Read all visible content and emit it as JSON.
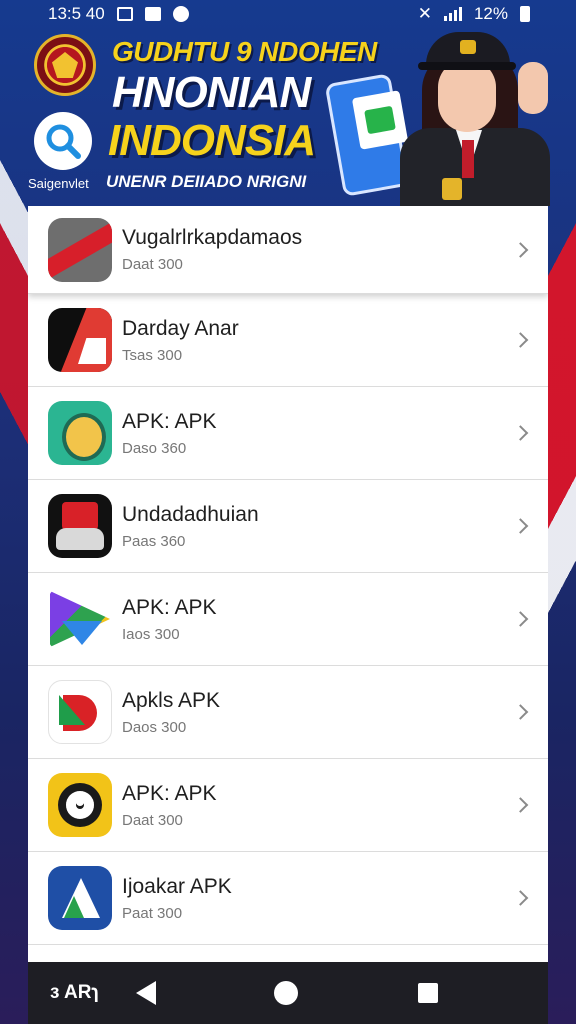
{
  "status_bar": {
    "time": "13:5 40",
    "battery_text": "12%"
  },
  "banner": {
    "brand_label": "Saigenvlet",
    "headline_line1": "GUDHTU 9 NDOHEN",
    "headline_line2": "HNONIAN",
    "headline_line3": "INDONSIA",
    "tagline": "UNENR DEIIADO NRIGNI"
  },
  "apps": [
    {
      "title": "Vugalrlrkapdamaos",
      "subtitle": "Daat 300",
      "icon": "red-ribbon-icon"
    },
    {
      "title": "Darday Anar",
      "subtitle": "Tsas 300",
      "icon": "black-red-logo-icon"
    },
    {
      "title": "APK: APK",
      "subtitle": "Daso 360",
      "icon": "golden-emblem-icon"
    },
    {
      "title": "Undadadhuian",
      "subtitle": "Paas 360",
      "icon": "red-machine-icon"
    },
    {
      "title": "APK: APK",
      "subtitle": "Iaos 300",
      "icon": "colorful-triangle-icon"
    },
    {
      "title": "Apkls APK",
      "subtitle": "Daos 300",
      "icon": "red-green-letter-icon"
    },
    {
      "title": "APK: APK",
      "subtitle": "Daat 300",
      "icon": "yellow-gear-icon"
    },
    {
      "title": "Ijoakar APK",
      "subtitle": "Paat 300",
      "icon": "blue-triangle-icon"
    }
  ],
  "nav_bar": {
    "left_label": "ɜ ARɿ"
  }
}
